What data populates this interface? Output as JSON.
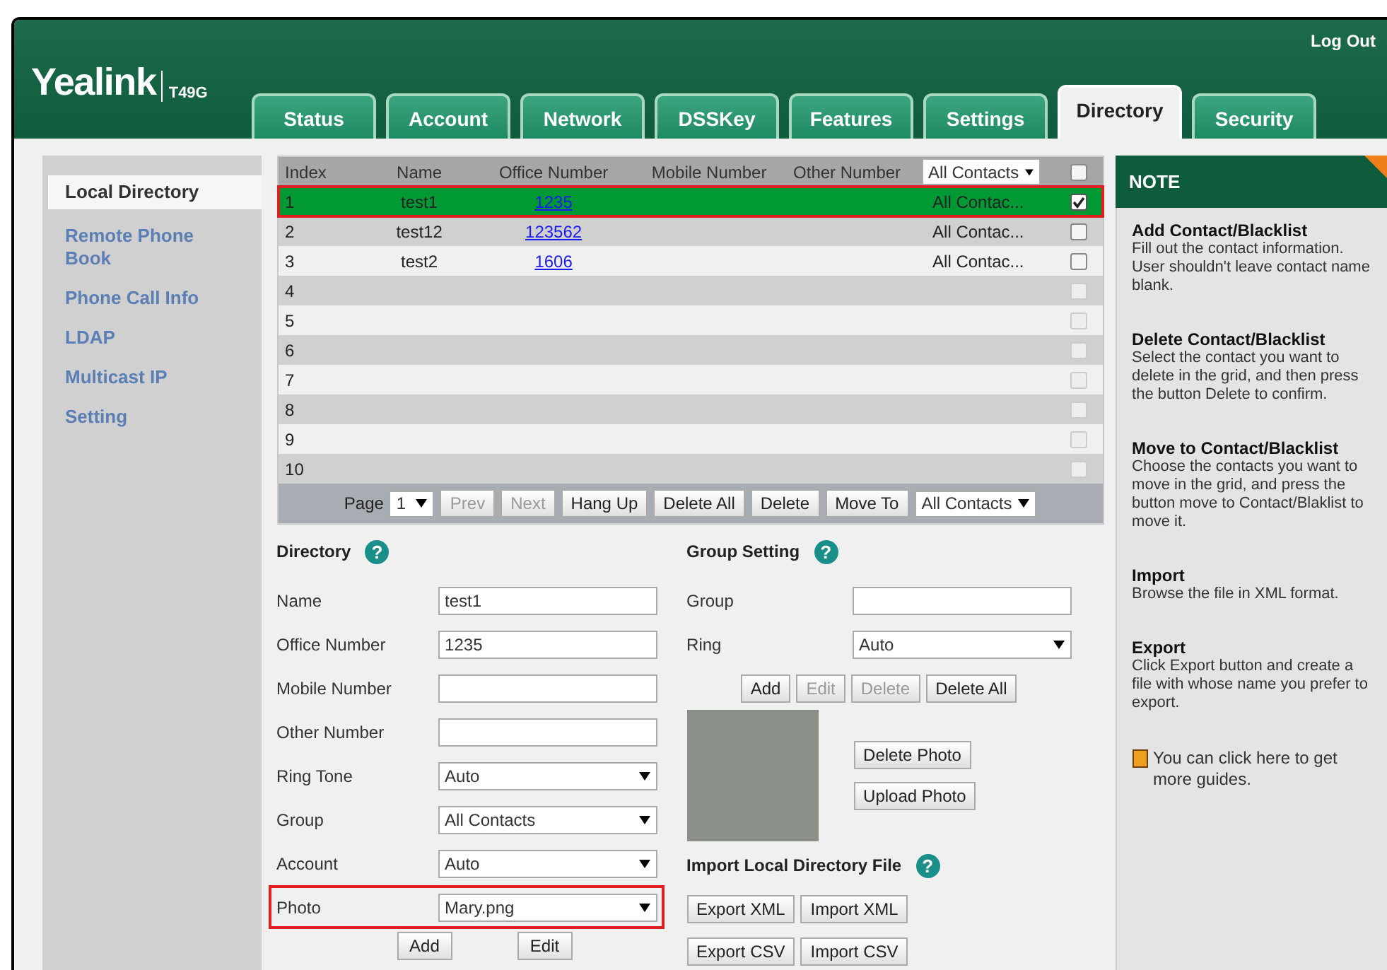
{
  "header": {
    "logo": "Yealink",
    "model": "T49G",
    "logout": "Log Out"
  },
  "tabs": [
    {
      "label": "Status",
      "selected": false
    },
    {
      "label": "Account",
      "selected": false
    },
    {
      "label": "Network",
      "selected": false
    },
    {
      "label": "DSSKey",
      "selected": false
    },
    {
      "label": "Features",
      "selected": false
    },
    {
      "label": "Settings",
      "selected": false
    },
    {
      "label": "Directory",
      "selected": true
    },
    {
      "label": "Security",
      "selected": false
    }
  ],
  "sidebar": {
    "items": [
      {
        "label": "Local Directory",
        "selected": true
      },
      {
        "label": "Remote Phone Book",
        "selected": false
      },
      {
        "label": "Phone Call Info",
        "selected": false
      },
      {
        "label": "LDAP",
        "selected": false
      },
      {
        "label": "Multicast IP",
        "selected": false
      },
      {
        "label": "Setting",
        "selected": false
      }
    ]
  },
  "table": {
    "columns": [
      "Index",
      "Name",
      "Office Number",
      "Mobile Number",
      "Other Number"
    ],
    "group_filter": "All Contacts",
    "select_all_checked": false,
    "rows": [
      {
        "index": "1",
        "name": "test1",
        "office_number": "1235",
        "group": "All Contac...",
        "checked": true,
        "selected": true,
        "highlighted": true,
        "disabled": false
      },
      {
        "index": "2",
        "name": "test12",
        "office_number": "123562",
        "group": "All Contac...",
        "checked": false,
        "selected": false,
        "highlighted": false,
        "disabled": false
      },
      {
        "index": "3",
        "name": "test2",
        "office_number": "1606",
        "group": "All Contac...",
        "checked": false,
        "selected": false,
        "highlighted": false,
        "disabled": false
      },
      {
        "index": "4",
        "checked": false,
        "selected": false,
        "highlighted": false,
        "disabled": true
      },
      {
        "index": "5",
        "checked": false,
        "selected": false,
        "highlighted": false,
        "disabled": true
      },
      {
        "index": "6",
        "checked": false,
        "selected": false,
        "highlighted": false,
        "disabled": true
      },
      {
        "index": "7",
        "checked": false,
        "selected": false,
        "highlighted": false,
        "disabled": true
      },
      {
        "index": "8",
        "checked": false,
        "selected": false,
        "highlighted": false,
        "disabled": true
      },
      {
        "index": "9",
        "checked": false,
        "selected": false,
        "highlighted": false,
        "disabled": true
      },
      {
        "index": "10",
        "checked": false,
        "selected": false,
        "highlighted": false,
        "disabled": true
      }
    ],
    "pager": {
      "label": "Page",
      "page": "1",
      "buttons": [
        {
          "label": "Prev",
          "disabled": true
        },
        {
          "label": "Next",
          "disabled": true
        },
        {
          "label": "Hang Up",
          "disabled": false
        },
        {
          "label": "Delete All",
          "disabled": false
        },
        {
          "label": "Delete",
          "disabled": false
        },
        {
          "label": "Move To",
          "disabled": false
        }
      ],
      "move_target": "All Contacts"
    }
  },
  "directory": {
    "title": "Directory",
    "help": "?",
    "fields": [
      {
        "label": "Name",
        "kind": "text",
        "value": "test1",
        "highlighted": false
      },
      {
        "label": "Office Number",
        "kind": "text",
        "value": "1235",
        "highlighted": false
      },
      {
        "label": "Mobile Number",
        "kind": "text",
        "highlighted": false
      },
      {
        "label": "Other Number",
        "kind": "text",
        "highlighted": false
      },
      {
        "label": "Ring Tone",
        "kind": "select",
        "value": "Auto",
        "highlighted": false
      },
      {
        "label": "Group",
        "kind": "select",
        "value": "All Contacts",
        "highlighted": false
      },
      {
        "label": "Account",
        "kind": "select",
        "value": "Auto",
        "highlighted": false
      },
      {
        "label": "Photo",
        "kind": "select",
        "value": "Mary.png",
        "highlighted": true
      }
    ],
    "buttons": [
      {
        "label": "Add",
        "disabled": false
      },
      {
        "label": "Edit",
        "disabled": false
      }
    ]
  },
  "group_setting": {
    "title": "Group Setting",
    "help": "?",
    "fields": [
      {
        "label": "Group",
        "kind": "text"
      },
      {
        "label": "Ring",
        "kind": "select",
        "value": "Auto"
      }
    ],
    "buttons": [
      {
        "label": "Add",
        "disabled": false
      },
      {
        "label": "Edit",
        "disabled": true
      },
      {
        "label": "Delete",
        "disabled": true
      },
      {
        "label": "Delete All",
        "disabled": false
      }
    ],
    "photo_buttons": [
      {
        "label": "Delete Photo",
        "disabled": false
      },
      {
        "label": "Upload Photo",
        "disabled": false
      }
    ]
  },
  "import": {
    "title": "Import Local Directory File",
    "help": "?",
    "button_rows": [
      [
        {
          "label": "Export XML",
          "disabled": false
        },
        {
          "label": "Import XML",
          "disabled": false
        }
      ],
      [
        {
          "label": "Export CSV",
          "disabled": false
        },
        {
          "label": "Import CSV",
          "disabled": false
        }
      ]
    ]
  },
  "note": {
    "title": "NOTE",
    "sections": [
      {
        "heading": "Add Contact/Blacklist",
        "text": "Fill out the contact information. User shouldn't leave contact name blank."
      },
      {
        "heading": "Delete Contact/Blacklist",
        "text": "Select the contact you want to delete in the grid, and then press the button Delete to confirm."
      },
      {
        "heading": "Move to Contact/Blacklist",
        "text": "Choose the contacts you want to move in the grid, and press the button move to Contact/Blaklist to move it."
      },
      {
        "heading": "Import",
        "text": "Browse the file in XML format."
      },
      {
        "heading": "Export",
        "text": "Click Export button and create a file with whose name you prefer to export."
      }
    ],
    "guide": "You can click here to get more guides."
  }
}
